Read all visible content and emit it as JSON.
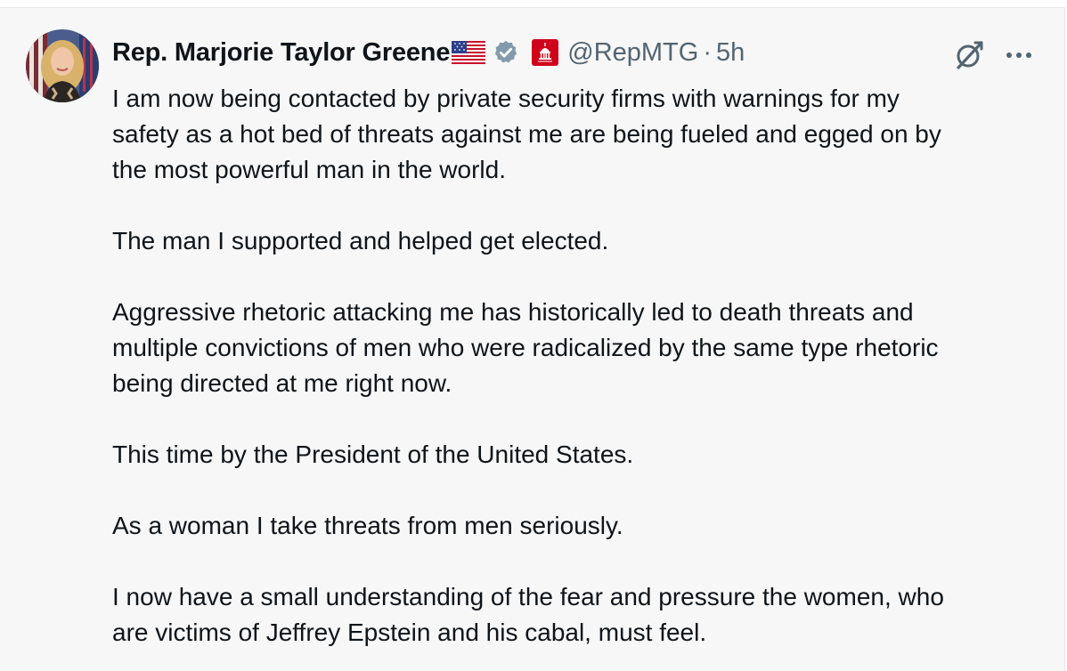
{
  "tweet": {
    "display_name": "Rep. Marjorie Taylor Greene",
    "handle": "@RepMTG",
    "separator": "·",
    "time": "5h",
    "lines": [
      "I am now being contacted by private security firms with warnings for my",
      "safety as a hot bed of threats against me are being fueled and egged on by",
      "the most powerful man in the world.",
      "",
      "The man I supported and helped get elected.",
      "",
      "Aggressive rhetoric attacking me has historically led to death threats and",
      "multiple convictions of men who were radicalized by the same type rhetoric",
      "being directed at me right now.",
      "",
      "This time by the President of the United States.",
      "",
      "As a woman I take threats from men seriously.",
      "",
      "I now have a small understanding of the fear and pressure the women, who",
      "are victims of Jeffrey Epstein and his cabal, must feel."
    ]
  },
  "icons": {
    "flag": "us-flag-icon",
    "verified": "verified-badge-icon",
    "affiliation": "us-capitol-affiliation-icon",
    "grok": "grok-icon",
    "more": "more-options-icon"
  },
  "colors": {
    "name_text": "#0f1419",
    "secondary_text": "#536471",
    "verified_badge": "#829aab",
    "affiliation_badge": "#d0021b",
    "card_background": "#f7f7f7"
  }
}
